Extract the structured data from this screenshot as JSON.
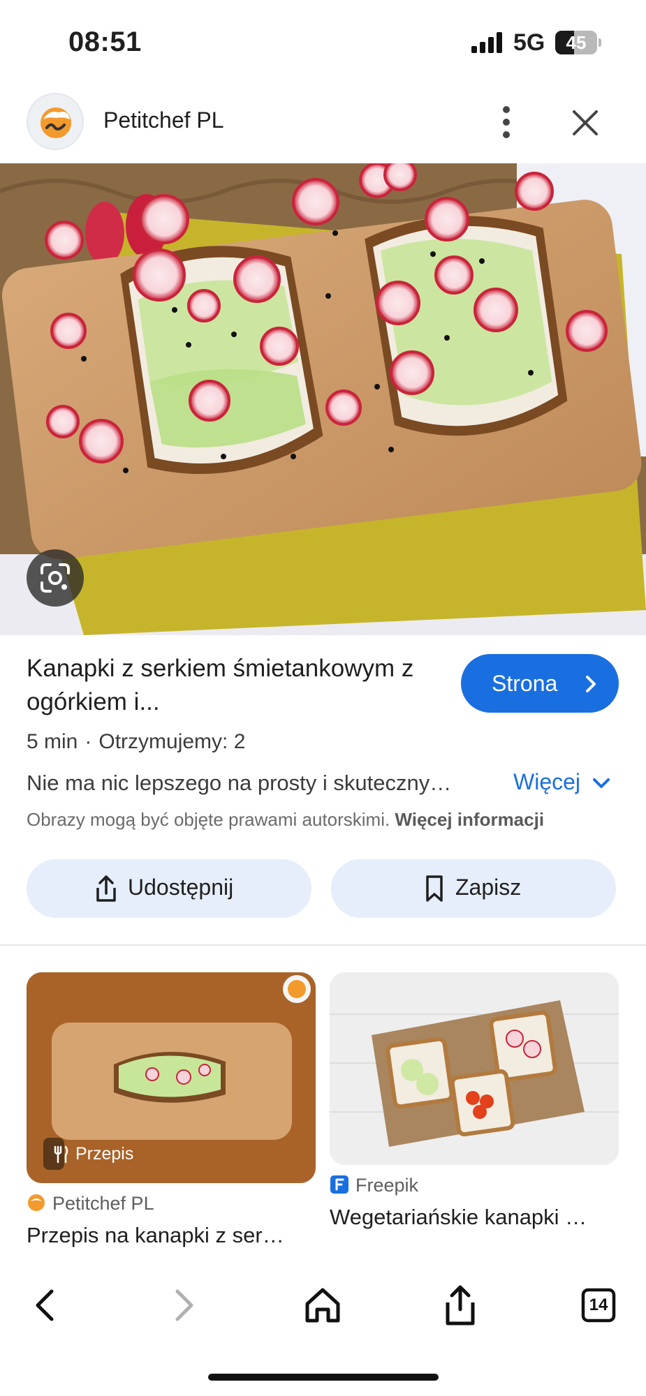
{
  "status_bar": {
    "time": "08:51",
    "network": "5G",
    "battery_level": "45"
  },
  "header": {
    "site_name": "Petitchef PL",
    "menu_icon": "more-vert-icon",
    "close_icon": "close-icon"
  },
  "hero": {
    "lens_icon": "google-lens-icon"
  },
  "result": {
    "title": "Kanapki z serkiem śmietankowym z ogórkiem i...",
    "visit_button": "Strona",
    "time": "5 min",
    "servings": "Otrzymujemy: 2",
    "description": "Nie ma nic lepszego na prosty i skuteczny…",
    "more_label": "Więcej",
    "copyright_text": "Obrazy mogą być objęte prawami autorskimi.",
    "copyright_link": "Więcej informacji"
  },
  "actions": {
    "share_label": "Udostępnij",
    "save_label": "Zapisz"
  },
  "related": [
    {
      "tag": "Przepis",
      "source": "Petitchef PL",
      "title": "Przepis na kanapki z ser…"
    },
    {
      "source": "Freepik",
      "title": "Wegetariańskie kanapki …"
    }
  ],
  "bottom_nav": {
    "tabs_count": "14"
  },
  "colors": {
    "accent": "#1a6fe0",
    "button_bg": "#e6eefb",
    "text": "#1f1f1f",
    "muted": "#6b6b6b"
  }
}
